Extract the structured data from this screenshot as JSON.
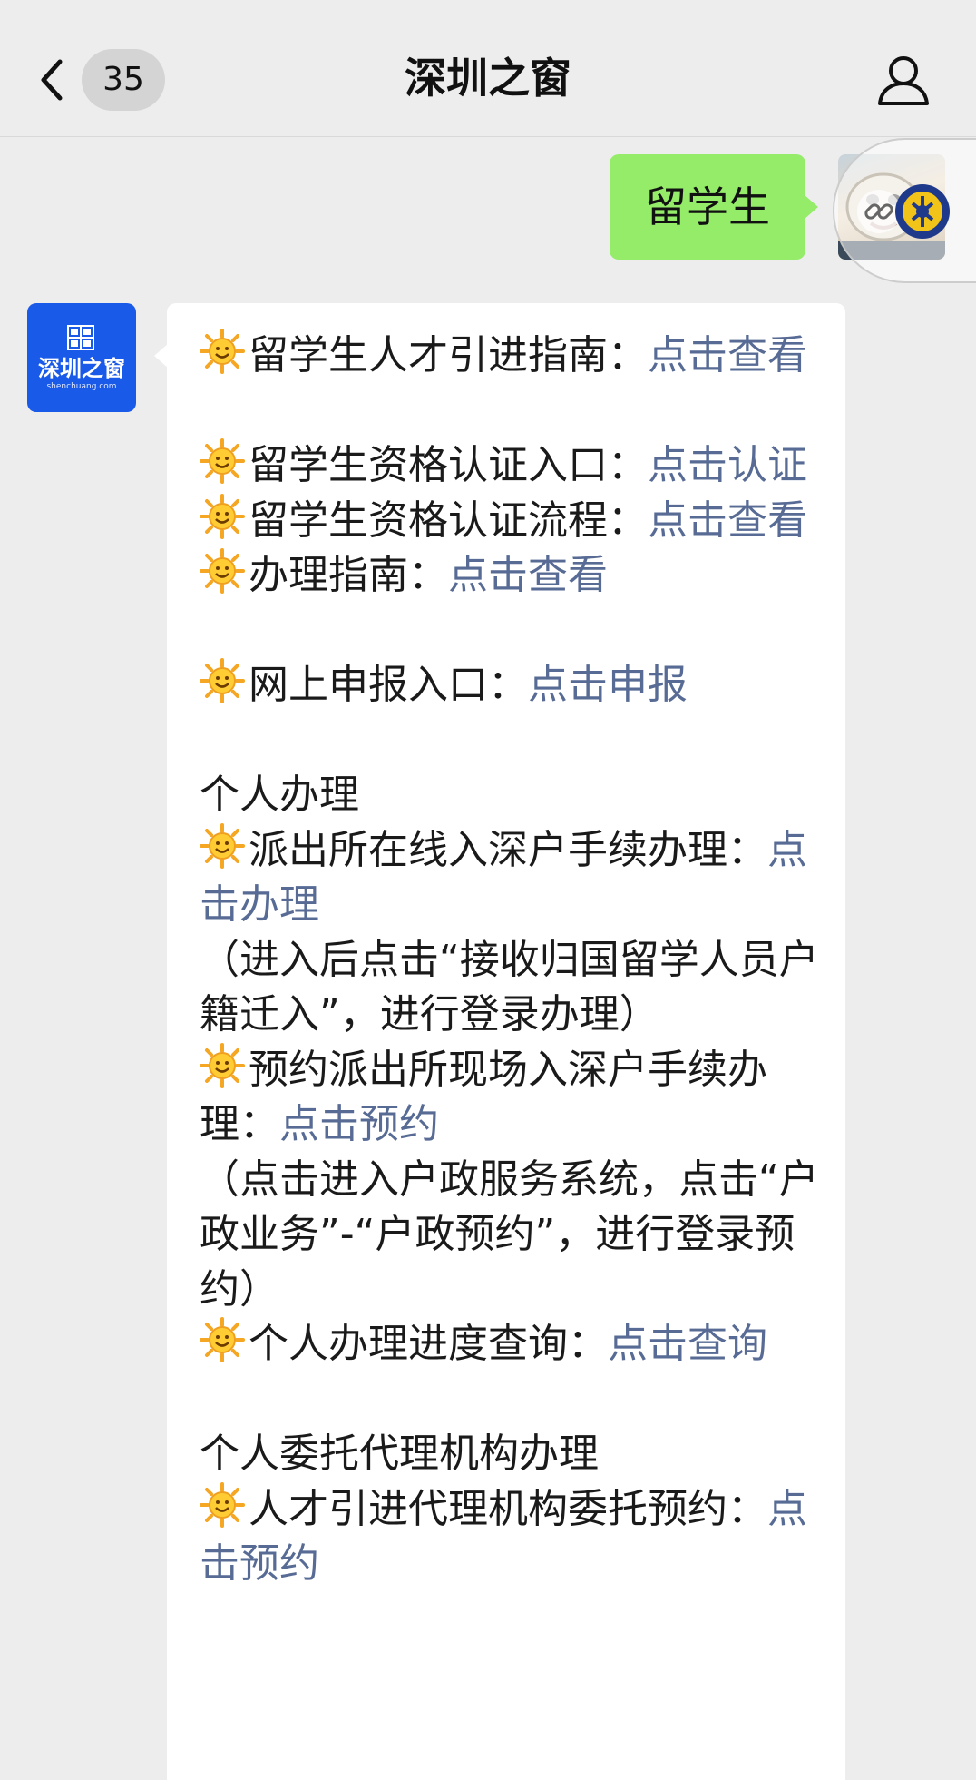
{
  "header": {
    "unread_count": "35",
    "title": "深圳之窗"
  },
  "sent_message": {
    "text": "留学生"
  },
  "account": {
    "avatar_name": "深圳之窗",
    "avatar_domain": "shenchuang.com"
  },
  "received_message": {
    "items": [
      {
        "label": "留学生人才引进指南：",
        "link": "点击查看"
      },
      {
        "label": "留学生资格认证入口：",
        "link": "点击认证"
      },
      {
        "label": "留学生资格认证流程：",
        "link": "点击查看"
      },
      {
        "label": "办理指南：",
        "link": "点击查看"
      },
      {
        "label": "网上申报入口：",
        "link": "点击申报"
      },
      {
        "section": "个人办理"
      },
      {
        "label": "派出所在线入深户手续办理：",
        "link": "点击办理",
        "note": "（进入后点击“接收归国留学人员户籍迁入”，进行登录办理）"
      },
      {
        "label": "预约派出所现场入深户手续办理：",
        "link": "点击预约",
        "note": "（点击进入户政服务系统，点击“户政业务”-“户政预约”，进行登录预约）"
      },
      {
        "label": "个人办理进度查询：",
        "link": "点击查询"
      },
      {
        "section": "个人委托代理机构办理"
      },
      {
        "label": "人才引进代理机构委托预约：",
        "link": "点击预约"
      }
    ]
  },
  "colors": {
    "background": "#ededed",
    "sent_bubble": "#95ec69",
    "link": "#576b95",
    "account_avatar": "#1a5ae8"
  },
  "icons": {
    "back": "chevron-left-icon",
    "profile": "person-icon",
    "bullet": "sun-emoji-icon",
    "float": "link-icon"
  }
}
